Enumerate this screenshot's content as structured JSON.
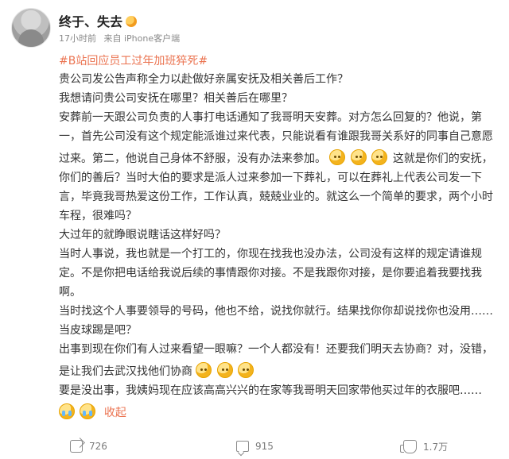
{
  "post": {
    "username": "终于、失去",
    "meta": {
      "time": "17小时前",
      "source": "来自 iPhone客户端"
    },
    "hashtag": "#B站回应员工过年加班猝死#",
    "paragraphs": [
      "贵公司发公告声称全力以赴做好亲属安抚及相关善后工作？",
      "我想请问贵公司安抚在哪里？相关善后在哪里？",
      "安葬前一天跟公司负责的人事打电话通知了我哥明天安葬。对方怎么回复的？他说，第一，首先公司没有这个规定能派谁过来代表，只能说看有谁跟我哥关系好的同事自己意愿过来。第二，他说自己身体不舒服，没有办法来参加。",
      "这就是你们的安抚，你们的善后？当时大伯的要求是派人过来参加一下葬礼，可以在葬礼上代表公司发一下言，毕竟我哥热爱这份工作，工作认真，兢兢业业的。就这么一个简单的要求，两个小时车程，很难吗？",
      "大过年的就睁眼说瞎话这样好吗？",
      "当时人事说，我也就是一个打工的，你现在找我也没办法，公司没有这样的规定请谁规定。不是你把电话给我说后续的事情跟你对接。不是我跟你对接，是你要追着我要找我啊。",
      "当时找这个人事要领导的号码，他也不给，说找你就行。结果找你你却说找你也没用……当皮球踢是吧？",
      "出事到现在你们有人过来看望一眼嘛？一个人都没有！还要我们明天去协商？对，没错，是让我们去武汉找他们协商",
      "要是没出事，我姨妈现在应该高高兴兴的在家等我哥明天回家带他买过年的衣服吧……"
    ],
    "collapse_label": "收起"
  },
  "actions": {
    "share_count": "726",
    "comment_count": "915",
    "like_count": "1.7万"
  },
  "colors": {
    "accent": "#eb7350",
    "text": "#333333",
    "muted": "#8a8a8a"
  },
  "icons": {
    "avatar": "avatar-image",
    "verified": "user-badge-icon",
    "share": "share-icon",
    "comment": "comment-icon",
    "like": "like-icon"
  }
}
